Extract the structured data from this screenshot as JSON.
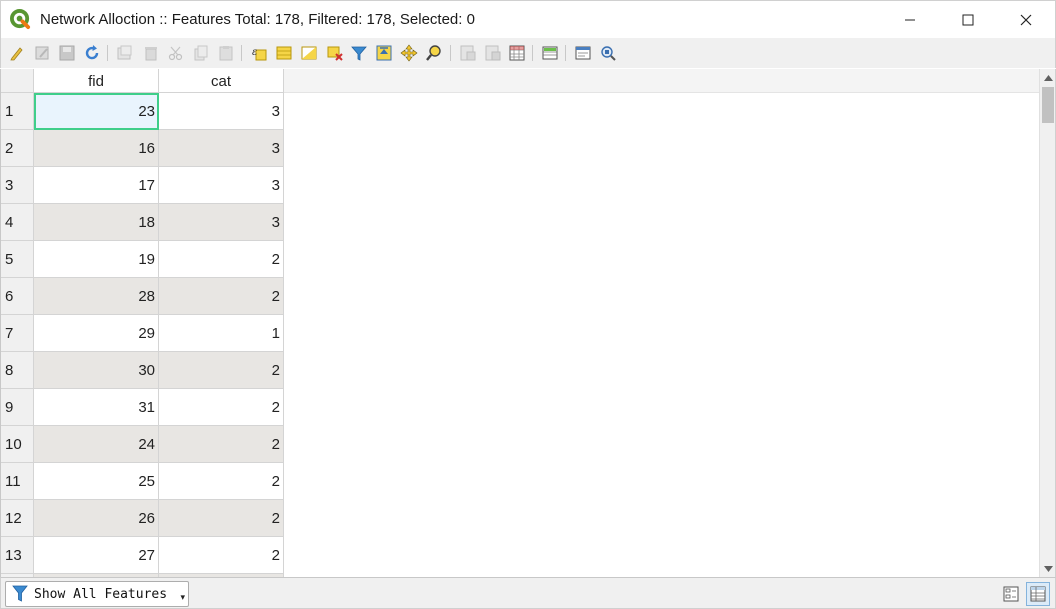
{
  "window": {
    "title": "Network Alloction :: Features Total: 178, Filtered: 178, Selected: 0",
    "controls": {
      "minimize": "minimize",
      "maximize": "maximize",
      "close": "close"
    }
  },
  "toolbar": {
    "icons": [
      "toggle-editing-icon",
      "toggle-multi-edit-icon",
      "save-edits-icon",
      "reload-table-icon",
      "add-feature-icon",
      "delete-selected-icon",
      "cut-icon",
      "copy-icon",
      "paste-icon",
      "select-by-expression-icon",
      "select-all-icon",
      "invert-selection-icon",
      "deselect-all-icon",
      "filter-select-icon",
      "move-selection-top-icon",
      "pan-to-selected-icon",
      "zoom-to-selected-icon",
      "new-field-icon",
      "delete-field-icon",
      "field-calculator-icon",
      "conditional-formatting-icon",
      "actions-icon",
      "dock-icon"
    ]
  },
  "table": {
    "columns": [
      "fid",
      "cat"
    ],
    "rows": [
      {
        "num": "1",
        "fid": "23",
        "cat": "3"
      },
      {
        "num": "2",
        "fid": "16",
        "cat": "3"
      },
      {
        "num": "3",
        "fid": "17",
        "cat": "3"
      },
      {
        "num": "4",
        "fid": "18",
        "cat": "3"
      },
      {
        "num": "5",
        "fid": "19",
        "cat": "2"
      },
      {
        "num": "6",
        "fid": "28",
        "cat": "2"
      },
      {
        "num": "7",
        "fid": "29",
        "cat": "1"
      },
      {
        "num": "8",
        "fid": "30",
        "cat": "2"
      },
      {
        "num": "9",
        "fid": "31",
        "cat": "2"
      },
      {
        "num": "10",
        "fid": "24",
        "cat": "2"
      },
      {
        "num": "11",
        "fid": "25",
        "cat": "2"
      },
      {
        "num": "12",
        "fid": "26",
        "cat": "2"
      },
      {
        "num": "13",
        "fid": "27",
        "cat": "2"
      }
    ],
    "selected_cell": {
      "row": 0,
      "column": "fid"
    }
  },
  "bottom": {
    "filter_button": "Show All Features",
    "view_modes": [
      "form-view-icon",
      "table-view-icon"
    ],
    "active_view": "table"
  },
  "colors": {
    "alt_row": "#e8e6e3",
    "selection_outline": "#3fce8a",
    "toolbar_bg": "#f0f0f0"
  }
}
